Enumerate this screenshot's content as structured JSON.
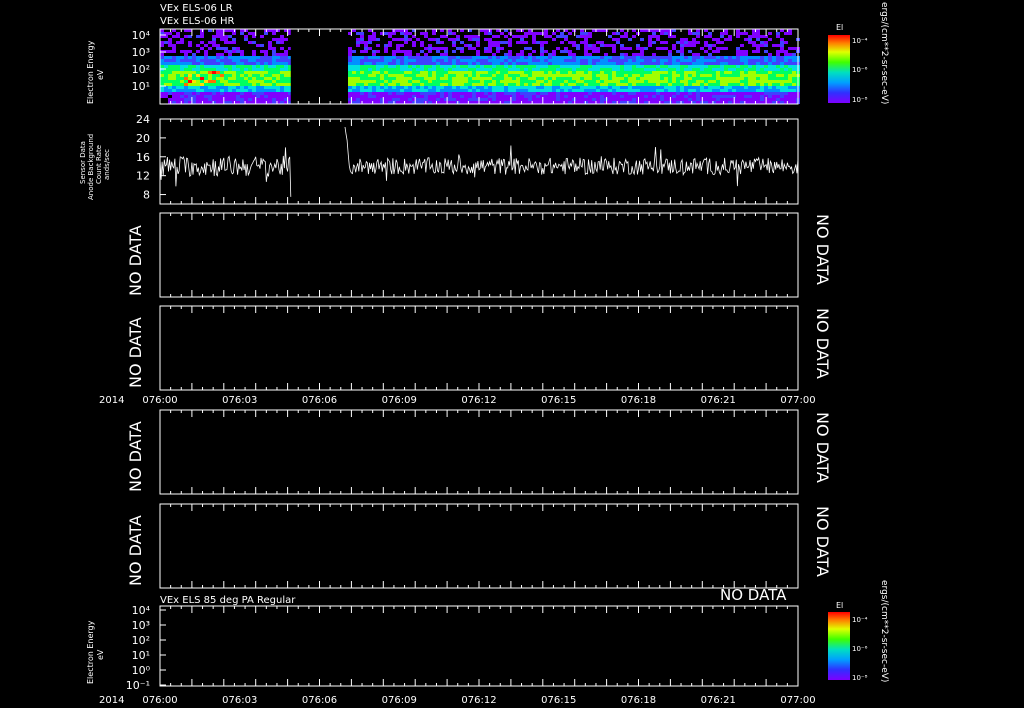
{
  "panels_titles": {
    "spectrogram_1_line1": "VEx  ELS-06  LR",
    "spectrogram_1_line2": "VEx  ELS-06  HR",
    "spectrogram_2": "VEx  ELS  85  deg  PA  Regular"
  },
  "no_data_label": "NO DATA",
  "year_label": "2014",
  "colorbar": {
    "title": "El",
    "unit_label": "ergs/(cm**2-sr-sec-eV)",
    "ticks": [
      "10⁻⁴",
      "10⁻⁶",
      "10⁻⁸"
    ]
  },
  "chart_data": [
    {
      "type": "heatmap",
      "name": "spectrogram-upper",
      "ylabel": "Electron Energy",
      "yunit": "eV",
      "yscale": "log",
      "yticks": [
        "10⁴",
        "10³",
        "10²",
        "10¹"
      ],
      "x_ticks": [
        "076:00",
        "076:03",
        "076:06",
        "076:09",
        "076:12",
        "076:15",
        "076:18",
        "076:21",
        "077:00"
      ],
      "data_gaps": [
        [
          "076:12.3",
          "076:17.5"
        ]
      ],
      "colorscale": [
        "#7f00ff",
        "#4040ff",
        "#0090ff",
        "#00e0e0",
        "#00ff60",
        "#a0ff00",
        "#ffe000",
        "#ff7000",
        "#ff0000"
      ]
    },
    {
      "type": "line",
      "name": "sensor-data",
      "ylabel_lines": [
        "Sensor Data",
        "Anode Background",
        "Count Rate",
        "ands/sec"
      ],
      "yticks": [
        24,
        20,
        16,
        12,
        8
      ],
      "ylim": [
        6,
        24
      ],
      "x_minutes_range": [
        0,
        60
      ],
      "series": [
        {
          "segments": [
            {
              "x_start": 0,
              "x_end": 12.3,
              "mean": 14,
              "spread": 2.2,
              "end_value": 7.5
            },
            {
              "x_start": 17.4,
              "x_end": 60,
              "mean": 14,
              "spread": 1.8,
              "start_values": [
                22,
                21,
                19,
                17
              ]
            }
          ]
        }
      ]
    },
    {
      "type": "empty",
      "name": "panel-3",
      "label": "NO DATA"
    },
    {
      "type": "empty",
      "name": "panel-4",
      "label": "NO DATA"
    },
    {
      "type": "axis",
      "name": "time-axis-1",
      "year": "2014",
      "ticks": [
        "076:00",
        "076:03",
        "076:06",
        "076:09",
        "076:12",
        "076:15",
        "076:18",
        "076:21",
        "077:00"
      ]
    },
    {
      "type": "empty",
      "name": "panel-5",
      "label": "NO DATA"
    },
    {
      "type": "empty",
      "name": "panel-6",
      "label": "NO DATA"
    },
    {
      "type": "heatmap",
      "name": "spectrogram-lower",
      "title": "VEx  ELS  85  deg  PA  Regular",
      "ylabel": "Electron Energy",
      "yunit": "eV",
      "yticks": [
        "10⁴",
        "10³",
        "10²",
        "10¹",
        "10⁰",
        "10⁻¹"
      ],
      "x_ticks": [
        "076:00",
        "076:03",
        "076:06",
        "076:09",
        "076:12",
        "076:15",
        "076:18",
        "076:21",
        "077:00"
      ],
      "status": "NO DATA"
    }
  ]
}
